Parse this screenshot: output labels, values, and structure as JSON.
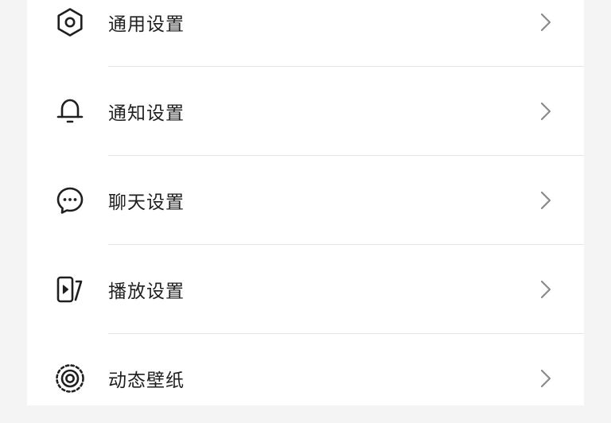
{
  "settings_list": {
    "items": [
      {
        "label": "通用设置",
        "icon": "gear-icon"
      },
      {
        "label": "通知设置",
        "icon": "bell-icon"
      },
      {
        "label": "聊天设置",
        "icon": "chat-bubble-icon"
      },
      {
        "label": "播放设置",
        "icon": "play-card-icon"
      },
      {
        "label": "动态壁纸",
        "icon": "live-wallpaper-icon"
      }
    ]
  }
}
